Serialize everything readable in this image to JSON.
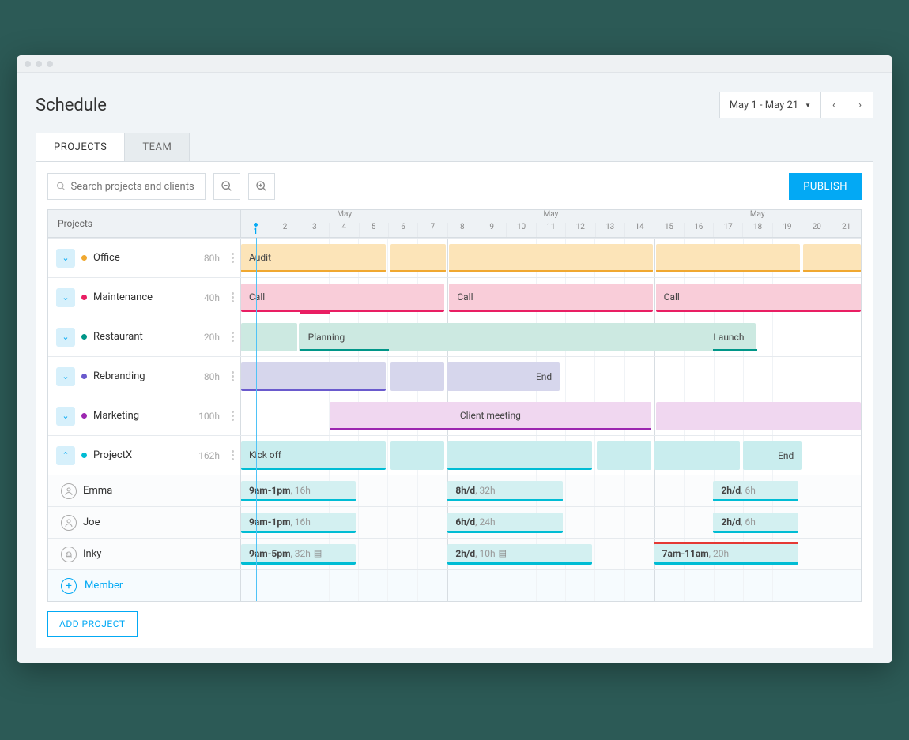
{
  "title": "Schedule",
  "date_range": "May 1 - May 21",
  "tabs": {
    "projects": "PROJECTS",
    "team": "TEAM"
  },
  "search_placeholder": "Search projects and clients",
  "publish": "PUBLISH",
  "header_label": "Projects",
  "month_label": "May",
  "add_member": "Member",
  "add_project": "ADD PROJECT",
  "colors": {
    "office": "#f7c978",
    "office_border": "#f0a830",
    "maint": "#f7b6c7",
    "maint_border": "#e91e63",
    "rest": "#b7e1d6",
    "rest_border": "#009688",
    "rebrand": "#c9c9e6",
    "rebrand_border": "#6a5acd",
    "marketing": "#e6c9e6",
    "marketing_border": "#9c27b0",
    "px": "#bde8ea",
    "px_border": "#00bcd4",
    "px_member": "#cdeeef"
  },
  "projects": [
    {
      "name": "Office",
      "hours": "80h",
      "chev": "down",
      "dot": "#f0a830",
      "bar_label": "Audit"
    },
    {
      "name": "Maintenance",
      "hours": "40h",
      "chev": "down",
      "dot": "#e91e63",
      "b1": "Call",
      "b2": "Call",
      "b3": "Call"
    },
    {
      "name": "Restaurant",
      "hours": "20h",
      "chev": "down",
      "dot": "#009688",
      "b1": "Planning",
      "b2": "Launch"
    },
    {
      "name": "Rebranding",
      "hours": "80h",
      "chev": "down",
      "dot": "#6a5acd",
      "b1": "End"
    },
    {
      "name": "Marketing",
      "hours": "100h",
      "chev": "down",
      "dot": "#9c27b0",
      "b1": "Client meeting"
    },
    {
      "name": "ProjectX",
      "hours": "162h",
      "chev": "up",
      "dot": "#00bcd4",
      "b1": "Kick off",
      "b2": "End"
    }
  ],
  "members": [
    {
      "name": "Emma",
      "s1a": "9am-1pm",
      "s1b": ", 16h",
      "s2a": "8h/d",
      "s2b": ", 32h",
      "s3a": "2h/d",
      "s3b": ", 6h"
    },
    {
      "name": "Joe",
      "s1a": "9am-1pm",
      "s1b": ", 16h",
      "s2a": "6h/d",
      "s2b": ", 24h",
      "s3a": "2h/d",
      "s3b": ", 6h"
    },
    {
      "name": "Inky",
      "s1a": "9am-5pm",
      "s1b": ", 32h",
      "s2a": "2h/d",
      "s2b": ", 10h",
      "s3a": "7am-11am",
      "s3b": ", 20h"
    }
  ]
}
